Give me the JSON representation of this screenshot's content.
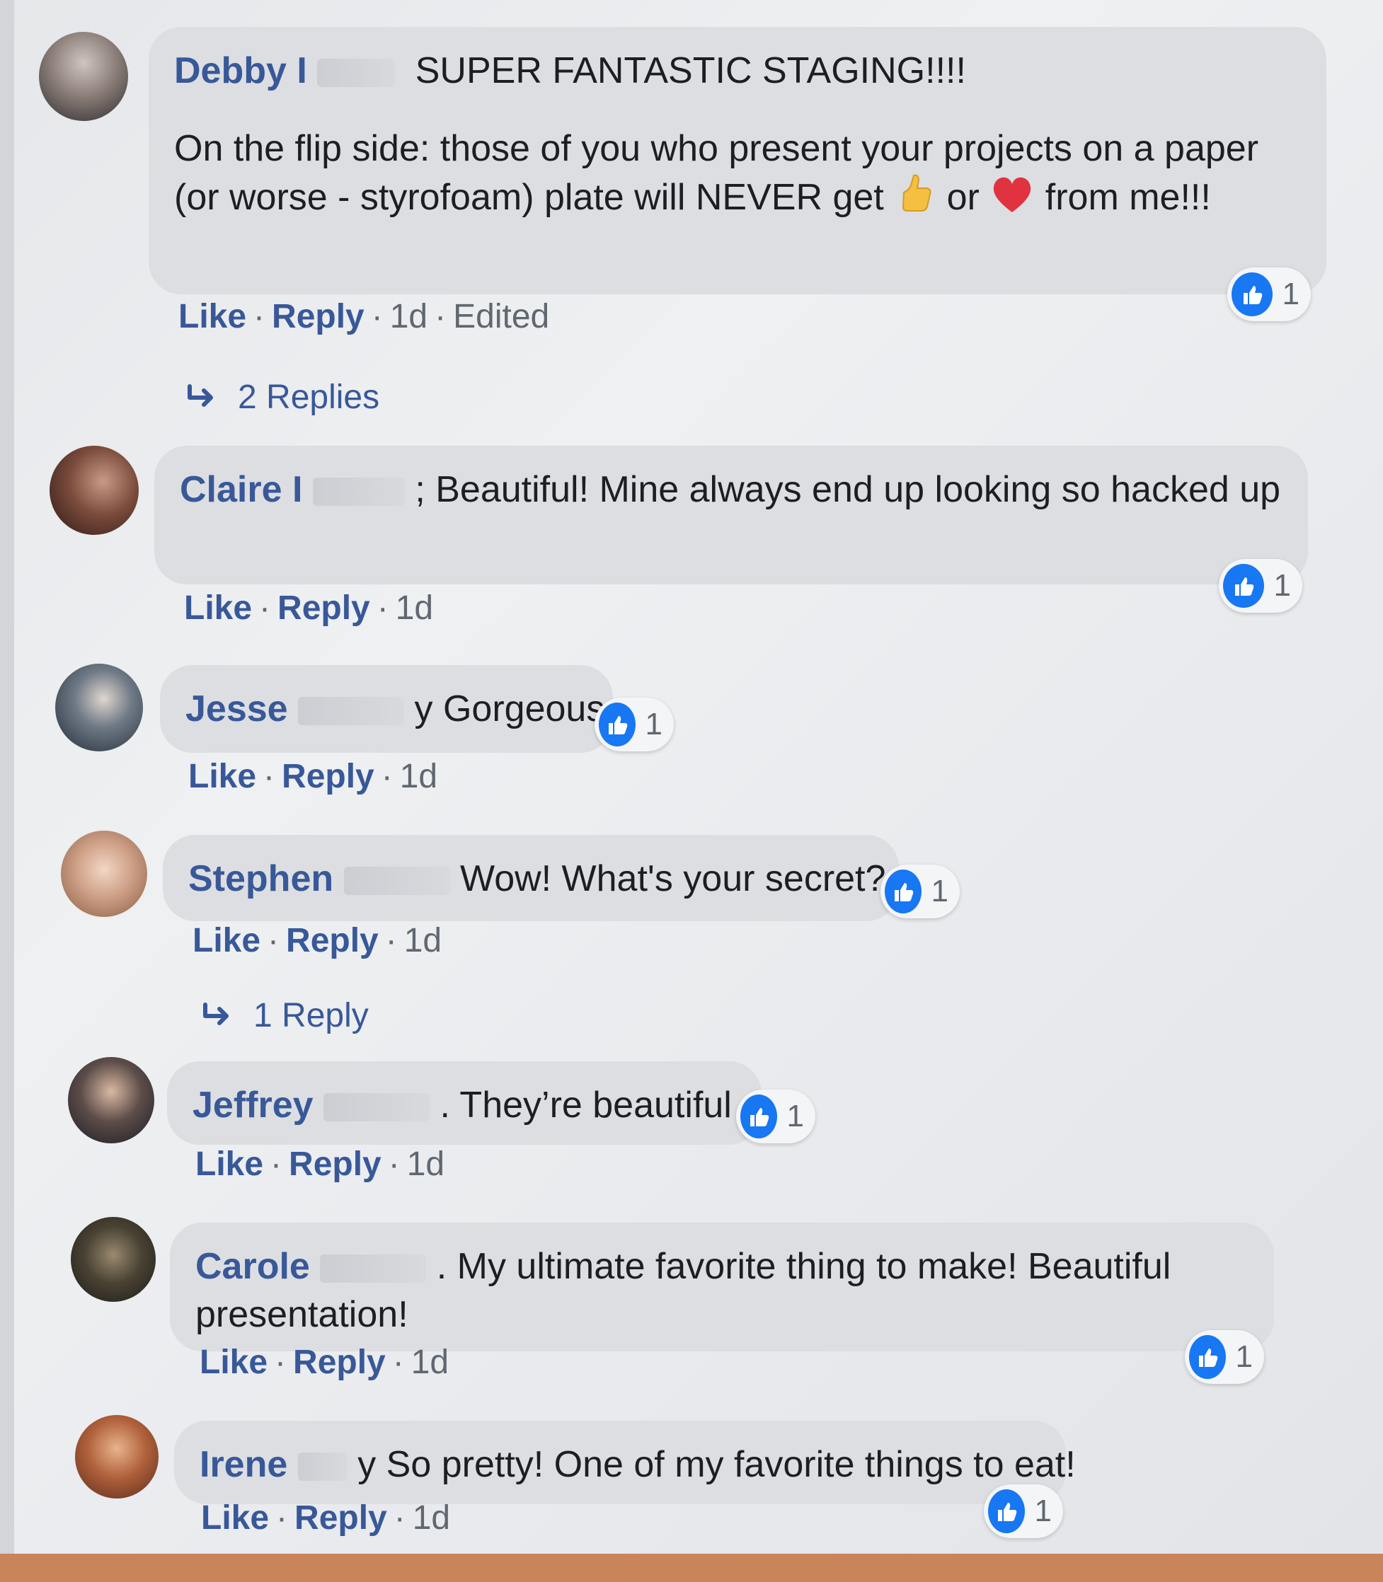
{
  "labels": {
    "like": "Like",
    "reply": "Reply",
    "dot": "·"
  },
  "colors": {
    "link": "#385898",
    "like_badge": "#1877f2",
    "bubble": "#dcdee2"
  },
  "comments": [
    {
      "name": "Debby I",
      "text_line1": "SUPER FANTASTIC STAGING!!!!",
      "text_part1": "On the flip side: those of you who present your projects on a paper (or worse - styrofoam) plate will NEVER get",
      "emoji1": "thumbs-up-emoji",
      "text_part2": "or",
      "emoji2": "heart-emoji",
      "text_part3": "from me!!!",
      "time": "1d",
      "edited": "Edited",
      "reactions": "1",
      "replies": "2 Replies"
    },
    {
      "name": "Claire I",
      "text": "; Beautiful! Mine always end up looking so hacked up",
      "time": "1d",
      "reactions": "1"
    },
    {
      "name": "Jesse",
      "text": "y Gorgeous",
      "time": "1d",
      "reactions": "1"
    },
    {
      "name": "Stephen",
      "text": "Wow! What's your secret?",
      "time": "1d",
      "reactions": "1",
      "replies": "1 Reply"
    },
    {
      "name": "Jeffrey",
      "text": ". They’re beautiful",
      "time": "1d",
      "reactions": "1"
    },
    {
      "name": "Carole",
      "text": ". My ultimate favorite thing to make! Beautiful presentation!",
      "time": "1d",
      "reactions": "1"
    },
    {
      "name": "Irene",
      "text": "y So pretty! One of my favorite things to eat!",
      "time": "1d",
      "reactions": "1"
    }
  ]
}
